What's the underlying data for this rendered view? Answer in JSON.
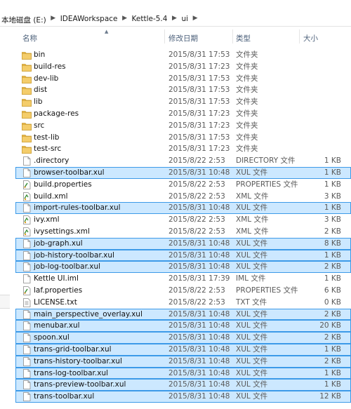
{
  "breadcrumb": [
    "本地磁盘 (E:)",
    "IDEAWorkspace",
    "Kettle-5.4",
    "ui"
  ],
  "columns": {
    "name": "名称",
    "date": "修改日期",
    "type": "类型",
    "size": "大小"
  },
  "rows": [
    {
      "name": "bin",
      "date": "2015/8/31 17:53",
      "type": "文件夹",
      "size": "",
      "icon": "folder-icon",
      "selected": false
    },
    {
      "name": "build-res",
      "date": "2015/8/31 17:23",
      "type": "文件夹",
      "size": "",
      "icon": "folder-icon",
      "selected": false
    },
    {
      "name": "dev-lib",
      "date": "2015/8/31 17:53",
      "type": "文件夹",
      "size": "",
      "icon": "folder-icon",
      "selected": false
    },
    {
      "name": "dist",
      "date": "2015/8/31 17:53",
      "type": "文件夹",
      "size": "",
      "icon": "folder-icon",
      "selected": false
    },
    {
      "name": "lib",
      "date": "2015/8/31 17:53",
      "type": "文件夹",
      "size": "",
      "icon": "folder-icon",
      "selected": false
    },
    {
      "name": "package-res",
      "date": "2015/8/31 17:23",
      "type": "文件夹",
      "size": "",
      "icon": "folder-icon",
      "selected": false
    },
    {
      "name": "src",
      "date": "2015/8/31 17:23",
      "type": "文件夹",
      "size": "",
      "icon": "folder-icon",
      "selected": false
    },
    {
      "name": "test-lib",
      "date": "2015/8/31 17:53",
      "type": "文件夹",
      "size": "",
      "icon": "folder-icon",
      "selected": false
    },
    {
      "name": "test-src",
      "date": "2015/8/31 17:23",
      "type": "文件夹",
      "size": "",
      "icon": "folder-icon",
      "selected": false
    },
    {
      "name": ".directory",
      "date": "2015/8/22 2:53",
      "type": "DIRECTORY 文件",
      "size": "1 KB",
      "icon": "file-icon",
      "selected": false
    },
    {
      "name": "browser-toolbar.xul",
      "date": "2015/8/31 10:48",
      "type": "XUL 文件",
      "size": "1 KB",
      "icon": "file-icon",
      "selected": true
    },
    {
      "name": "build.properties",
      "date": "2015/8/22 2:53",
      "type": "PROPERTIES 文件",
      "size": "1 KB",
      "icon": "properties-file-icon",
      "selected": false
    },
    {
      "name": "build.xml",
      "date": "2015/8/22 2:53",
      "type": "XML 文件",
      "size": "3 KB",
      "icon": "xml-file-icon",
      "selected": false
    },
    {
      "name": "import-rules-toolbar.xul",
      "date": "2015/8/31 10:48",
      "type": "XUL 文件",
      "size": "1 KB",
      "icon": "file-icon",
      "selected": true
    },
    {
      "name": "ivy.xml",
      "date": "2015/8/22 2:53",
      "type": "XML 文件",
      "size": "3 KB",
      "icon": "xml-file-icon",
      "selected": false
    },
    {
      "name": "ivysettings.xml",
      "date": "2015/8/22 2:53",
      "type": "XML 文件",
      "size": "2 KB",
      "icon": "xml-file-icon",
      "selected": false
    },
    {
      "name": "job-graph.xul",
      "date": "2015/8/31 10:48",
      "type": "XUL 文件",
      "size": "8 KB",
      "icon": "file-icon",
      "selected": true
    },
    {
      "name": "job-history-toolbar.xul",
      "date": "2015/8/31 10:48",
      "type": "XUL 文件",
      "size": "1 KB",
      "icon": "file-icon",
      "selected": true
    },
    {
      "name": "job-log-toolbar.xul",
      "date": "2015/8/31 10:48",
      "type": "XUL 文件",
      "size": "2 KB",
      "icon": "file-icon",
      "selected": true
    },
    {
      "name": "Kettle UI.iml",
      "date": "2015/8/31 17:39",
      "type": "IML 文件",
      "size": "1 KB",
      "icon": "file-icon",
      "selected": false
    },
    {
      "name": "laf.properties",
      "date": "2015/8/22 2:53",
      "type": "PROPERTIES 文件",
      "size": "6 KB",
      "icon": "properties-file-icon",
      "selected": false
    },
    {
      "name": "LICENSE.txt",
      "date": "2015/8/22 2:53",
      "type": "TXT 文件",
      "size": "0 KB",
      "icon": "text-file-icon",
      "selected": false
    },
    {
      "name": "main_perspective_overlay.xul",
      "date": "2015/8/31 10:48",
      "type": "XUL 文件",
      "size": "2 KB",
      "icon": "file-icon",
      "selected": true
    },
    {
      "name": "menubar.xul",
      "date": "2015/8/31 10:48",
      "type": "XUL 文件",
      "size": "20 KB",
      "icon": "file-icon",
      "selected": true
    },
    {
      "name": "spoon.xul",
      "date": "2015/8/31 10:48",
      "type": "XUL 文件",
      "size": "2 KB",
      "icon": "file-icon",
      "selected": true
    },
    {
      "name": "trans-grid-toolbar.xul",
      "date": "2015/8/31 10:48",
      "type": "XUL 文件",
      "size": "1 KB",
      "icon": "file-icon",
      "selected": true
    },
    {
      "name": "trans-history-toolbar.xul",
      "date": "2015/8/31 10:48",
      "type": "XUL 文件",
      "size": "2 KB",
      "icon": "file-icon",
      "selected": true
    },
    {
      "name": "trans-log-toolbar.xul",
      "date": "2015/8/31 10:48",
      "type": "XUL 文件",
      "size": "1 KB",
      "icon": "file-icon",
      "selected": true
    },
    {
      "name": "trans-preview-toolbar.xul",
      "date": "2015/8/31 10:48",
      "type": "XUL 文件",
      "size": "1 KB",
      "icon": "file-icon",
      "selected": true
    },
    {
      "name": "trans-toolbar.xul",
      "date": "2015/8/31 10:48",
      "type": "XUL 文件",
      "size": "12 KB",
      "icon": "file-icon",
      "selected": true
    }
  ],
  "colors": {
    "selection_fill": "#cce8ff",
    "selection_border": "#3c9ae8",
    "folder": "#e8b84a",
    "header_text": "#4c607a"
  }
}
